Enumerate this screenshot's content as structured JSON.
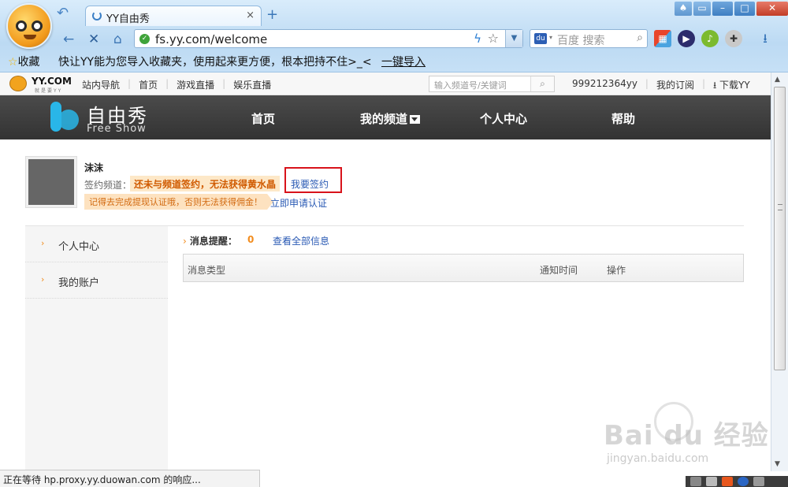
{
  "browser": {
    "tab_title": "YY自由秀",
    "tab_close": "×",
    "new_tab": "+",
    "url": "fs.yy.com/welcome",
    "search_placeholder": "百度 搜索",
    "favorites_label": "收藏",
    "favorites_tip": "快让YY能为您导入收藏夹，使用起来更方便，根本把持不住>_<",
    "import_link": "一键导入",
    "status_text": "正在等待 hp.proxy.yy.duowan.com 的响应..."
  },
  "site_topbar": {
    "logo_text": "YY.COM",
    "logo_sub": "就是要YY",
    "nav": [
      "站内导航",
      "首页",
      "游戏直播",
      "娱乐直播"
    ],
    "search_placeholder": "输入频道号/关键词",
    "user_id": "999212364yy",
    "my_subscriptions": "我的订阅",
    "download": "下载YY"
  },
  "header": {
    "brand_cn": "自由秀",
    "brand_en": "Free Show",
    "nav": [
      "首页",
      "我的频道",
      "个人中心",
      "帮助"
    ]
  },
  "profile": {
    "name": "沫沫",
    "sign_label": "签约频道：",
    "sign_warning": "还未与频道签约，无法获得黄水晶",
    "sign_button": "我要签约",
    "cert_tip": "记得去完成提现认证哦，否则无法获得佣金！",
    "cert_link": "立即申请认证"
  },
  "sidebar": {
    "items": [
      "个人中心",
      "我的账户"
    ]
  },
  "messages": {
    "title": "消息提醒：",
    "count": "0",
    "view_all": "查看全部信息",
    "columns": [
      "消息类型",
      "通知时间",
      "操作"
    ]
  },
  "watermark": {
    "text": "Bai du 经验",
    "sub": "jingyan.baidu.com"
  },
  "colors": {
    "accent_orange": "#f28c1e",
    "link_blue": "#2a5ab4",
    "highlight_red": "#d8131b",
    "header_dark": "#3d3d3d"
  }
}
